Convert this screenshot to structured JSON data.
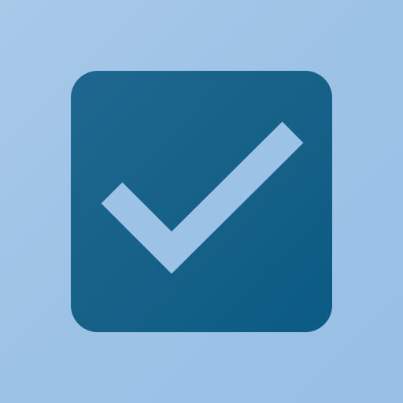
{
  "app_icon": {
    "icon_name": "checkbox-checked-icon",
    "state": "checked",
    "colors": {
      "background_start": "#a8c9e8",
      "background_end": "#9bc0e5",
      "tile_start": "#1f6790",
      "tile_end": "#0b5b85",
      "checkmark": "#9cc3e6"
    }
  }
}
